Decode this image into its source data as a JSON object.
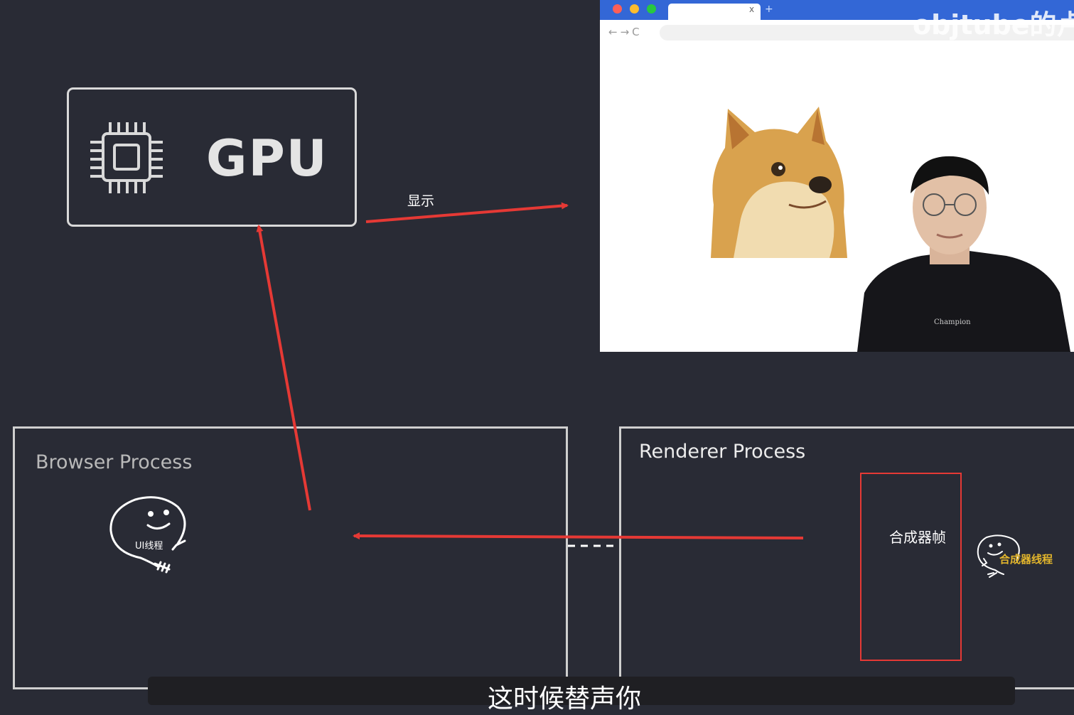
{
  "gpu": {
    "label": "GPU",
    "icon": "cpu-chip-icon"
  },
  "display_label": "显示",
  "browser_process": {
    "title": "Browser Process",
    "thread_label": "UI线程"
  },
  "renderer_process": {
    "title": "Renderer Process",
    "frame_label": "合成器帧",
    "thread_label": "合成器线程"
  },
  "screen_preview": {
    "watermark": "objtube的卢"
  },
  "subtitle": "这时候替声你",
  "colors": {
    "background": "#292b35",
    "arrow": "#e53935",
    "accent_thread": "#e3b62c",
    "browser_titlebar": "#3367d6"
  }
}
